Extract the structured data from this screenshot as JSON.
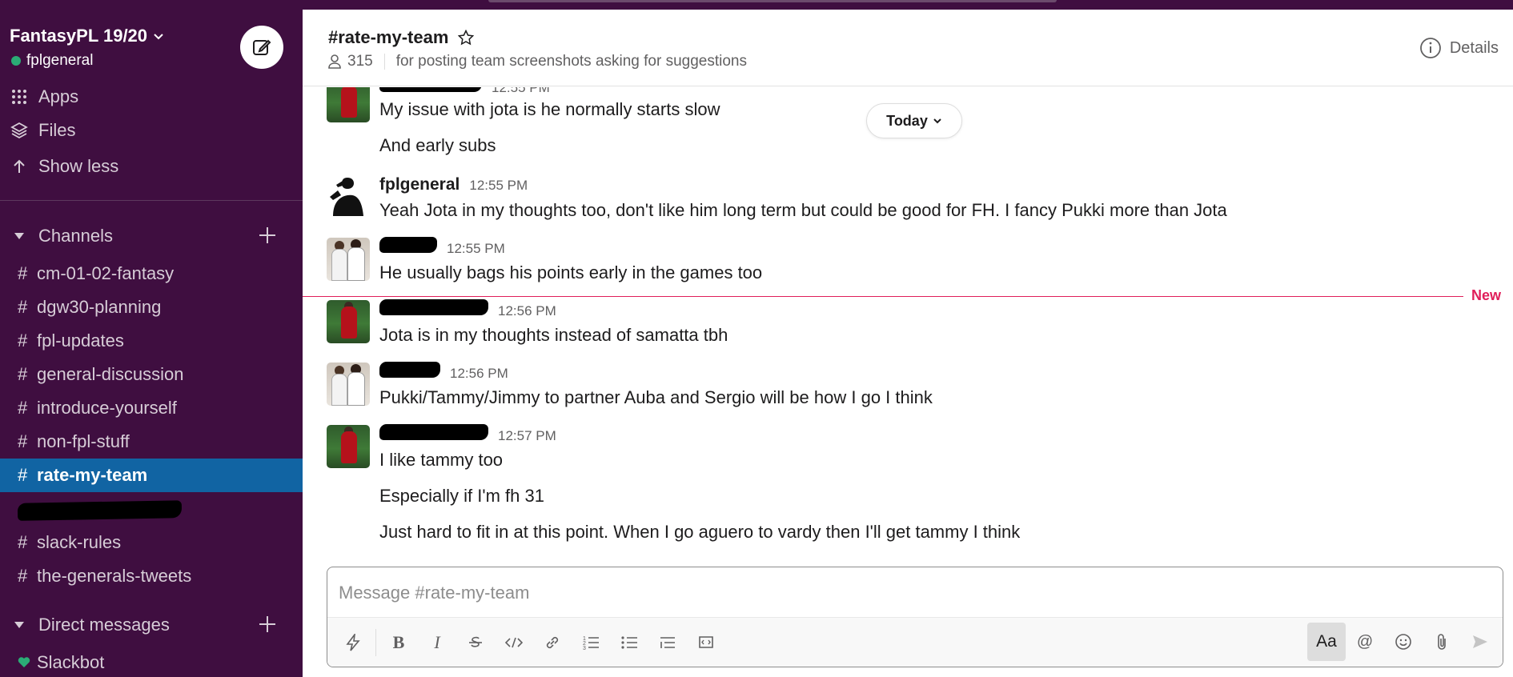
{
  "workspace": {
    "name": "FantasyPL 19/20",
    "user": "fplgeneral"
  },
  "sidebar": {
    "top_items": [
      {
        "label": "Apps",
        "icon": "apps-grid-icon"
      },
      {
        "label": "Files",
        "icon": "files-layers-icon"
      },
      {
        "label": "Show less",
        "icon": "arrow-up-icon"
      }
    ],
    "channels_label": "Channels",
    "channels": [
      "cm-01-02-fantasy",
      "dgw30-planning",
      "fpl-updates",
      "general-discussion",
      "introduce-yourself",
      "non-fpl-stuff",
      "rate-my-team",
      "slack-rules",
      "the-generals-tweets"
    ],
    "active_channel": "rate-my-team",
    "dm_label": "Direct messages",
    "dms": [
      "Slackbot"
    ]
  },
  "channel": {
    "name": "#rate-my-team",
    "members": "315",
    "topic": "for posting team screenshots asking for suggestions",
    "details_label": "Details"
  },
  "messages": {
    "today_label": "Today",
    "new_label": "New",
    "groups": [
      {
        "sender": "",
        "time": "12:55 PM",
        "lines": [
          "My issue with jota is he normally starts slow",
          "And early subs"
        ]
      },
      {
        "sender": "fplgeneral",
        "time": "12:55 PM",
        "lines": [
          "Yeah Jota in my thoughts too, don't like him long term but could be good for FH. I fancy Pukki more than Jota"
        ]
      },
      {
        "sender": "",
        "time": "12:55 PM",
        "lines": [
          "He usually bags his points early in the games too"
        ]
      },
      {
        "sender": "",
        "time": "12:56 PM",
        "lines": [
          "Jota is in my thoughts instead of samatta tbh"
        ]
      },
      {
        "sender": "",
        "time": "12:56 PM",
        "lines": [
          "Pukki/Tammy/Jimmy to partner Auba and Sergio will be how I go I think"
        ]
      },
      {
        "sender": "",
        "time": "12:57 PM",
        "lines": [
          "I like tammy too",
          "Especially if I'm fh 31",
          "Just hard to fit in at this point. When I go aguero to vardy then I'll get tammy I think"
        ]
      }
    ]
  },
  "composer": {
    "placeholder": "Message #rate-my-team",
    "aa_label": "Aa",
    "at_label": "@"
  },
  "colors": {
    "sidebar_bg": "#3f0e40",
    "active_channel_bg": "#1164a3",
    "new_marker": "#e01e5a",
    "online": "#2bac76"
  }
}
